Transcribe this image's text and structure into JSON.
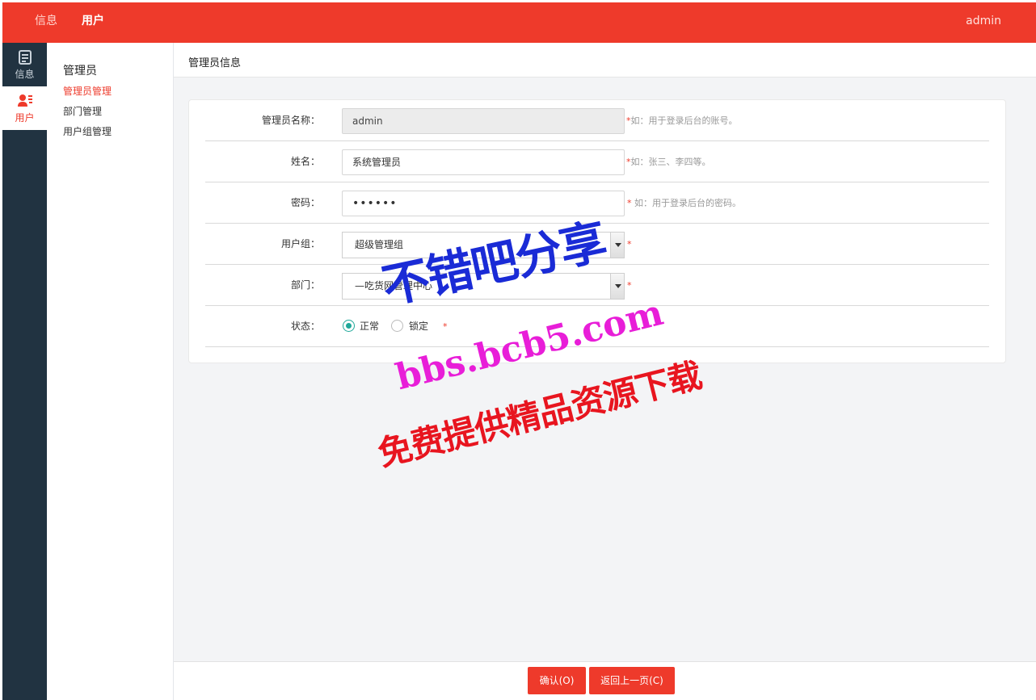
{
  "topbar": {
    "nav": [
      "信息",
      "用户"
    ],
    "user": "admin",
    "color": "#ee3a2b"
  },
  "rail": [
    {
      "label": "信息",
      "icon": "document-icon"
    },
    {
      "label": "用户",
      "icon": "user-list-icon"
    }
  ],
  "subnav": {
    "heading": "管理员",
    "items": [
      "管理员管理",
      "部门管理",
      "用户组管理"
    ]
  },
  "page_title": "管理员信息",
  "form": {
    "admin_name": {
      "label": "管理员名称：",
      "value": "admin",
      "hint": "如：用于登录后台的账号。"
    },
    "real_name": {
      "label": "姓名：",
      "value": "系统管理员",
      "hint": "如：张三、李四等。"
    },
    "password": {
      "label": "密码：",
      "value": "••••••",
      "hint": "如：用于登录后台的密码。"
    },
    "group": {
      "label": "用户组：",
      "value": "超级管理组"
    },
    "dept": {
      "label": "部门：",
      "value": "—吃货网管理中心"
    },
    "status": {
      "label": "状态：",
      "options": [
        "正常",
        "锁定"
      ],
      "selected": "正常"
    },
    "required_mark": "*"
  },
  "buttons": {
    "confirm": "确认(O)",
    "back": "返回上一页(C)"
  },
  "watermark": {
    "line1": "不错吧分享",
    "line2": "bbs.bcb5.com",
    "line3": "免费提供精品资源下载"
  }
}
